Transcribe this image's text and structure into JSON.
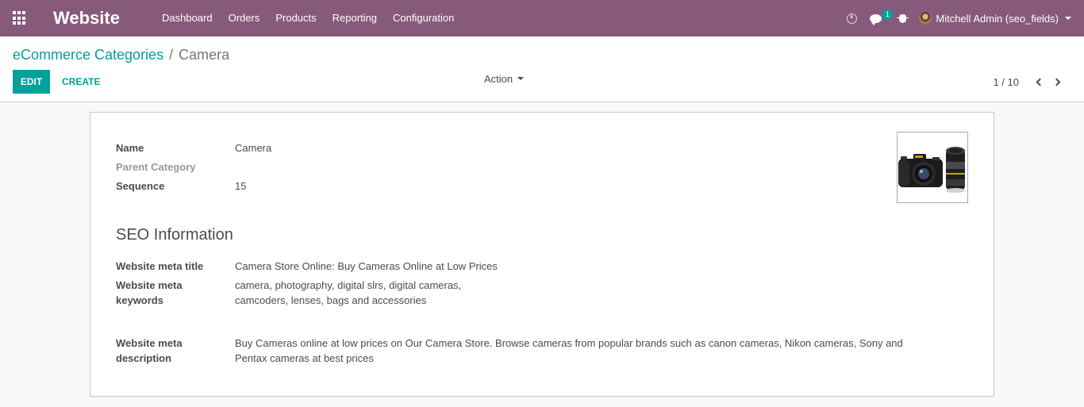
{
  "navbar": {
    "brand": "Website",
    "menu": [
      "Dashboard",
      "Orders",
      "Products",
      "Reporting",
      "Configuration"
    ],
    "chat_badge": "1",
    "user": "Mitchell Admin (seo_fields)",
    "colors": {
      "bar": "#875a7b",
      "accent": "#00a09d"
    }
  },
  "breadcrumb": {
    "parent": "eCommerce Categories",
    "separator": "/",
    "current": "Camera"
  },
  "buttons": {
    "edit": "EDIT",
    "create": "CREATE",
    "action": "Action"
  },
  "pager": {
    "value": "1 / 10"
  },
  "form": {
    "fields": [
      {
        "label": "Name",
        "value": "Camera"
      },
      {
        "label": "Parent Category",
        "value": ""
      },
      {
        "label": "Sequence",
        "value": "15"
      }
    ],
    "image_icon": "camera-product-image",
    "seo_section": "SEO Information",
    "seo_fields": [
      {
        "label": "Website meta title",
        "value": "Camera Store Online: Buy Cameras Online at Low Prices"
      },
      {
        "label_line1": "Website meta",
        "label_line2": "keywords",
        "value_line1": "camera, photography, digital slrs, digital cameras,",
        "value_line2": "camcoders, lenses, bags and accessories"
      },
      {
        "label_line1": "Website meta",
        "label_line2": "description",
        "value_line1": "Buy Cameras online at low prices on Our Camera Store. Browse cameras from popular brands such as canon cameras, Nikon cameras, Sony and",
        "value_line2": "Pentax cameras at best prices"
      }
    ]
  }
}
